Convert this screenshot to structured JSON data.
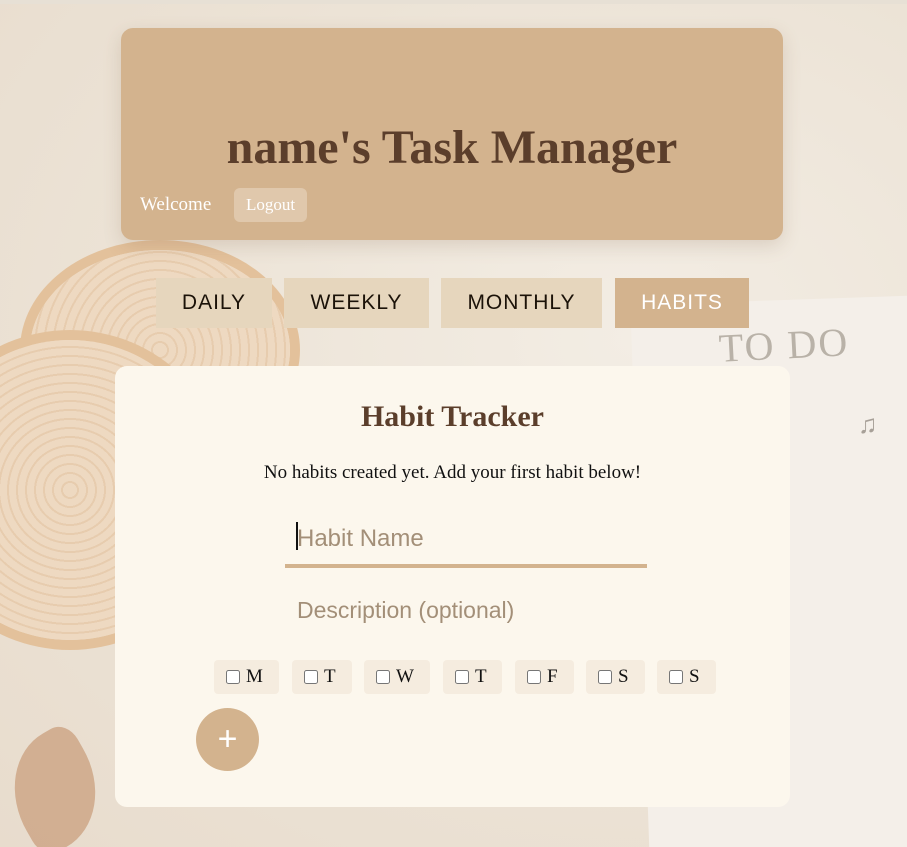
{
  "header": {
    "title": "name's Task Manager",
    "welcome": "Welcome",
    "logout_label": "Logout"
  },
  "tabs": [
    {
      "label": "DAILY",
      "active": false
    },
    {
      "label": "WEEKLY",
      "active": false
    },
    {
      "label": "MONTHLY",
      "active": false
    },
    {
      "label": "HABITS",
      "active": true
    }
  ],
  "habit_tracker": {
    "title": "Habit Tracker",
    "empty_message": "No habits created yet. Add your first habit below!",
    "name_placeholder": "Habit Name",
    "description_placeholder": "Description (optional)",
    "days": [
      {
        "label": "M",
        "checked": false
      },
      {
        "label": "T",
        "checked": false
      },
      {
        "label": "W",
        "checked": false
      },
      {
        "label": "T",
        "checked": false
      },
      {
        "label": "F",
        "checked": false
      },
      {
        "label": "S",
        "checked": false
      },
      {
        "label": "S",
        "checked": false
      }
    ],
    "add_label": "+"
  },
  "background": {
    "text": "TO DO LIS"
  },
  "colors": {
    "accent": "#d3b38e",
    "tab_inactive": "#e6d6bd",
    "heading": "#5b3e2b",
    "card": "#fcf7ed"
  }
}
